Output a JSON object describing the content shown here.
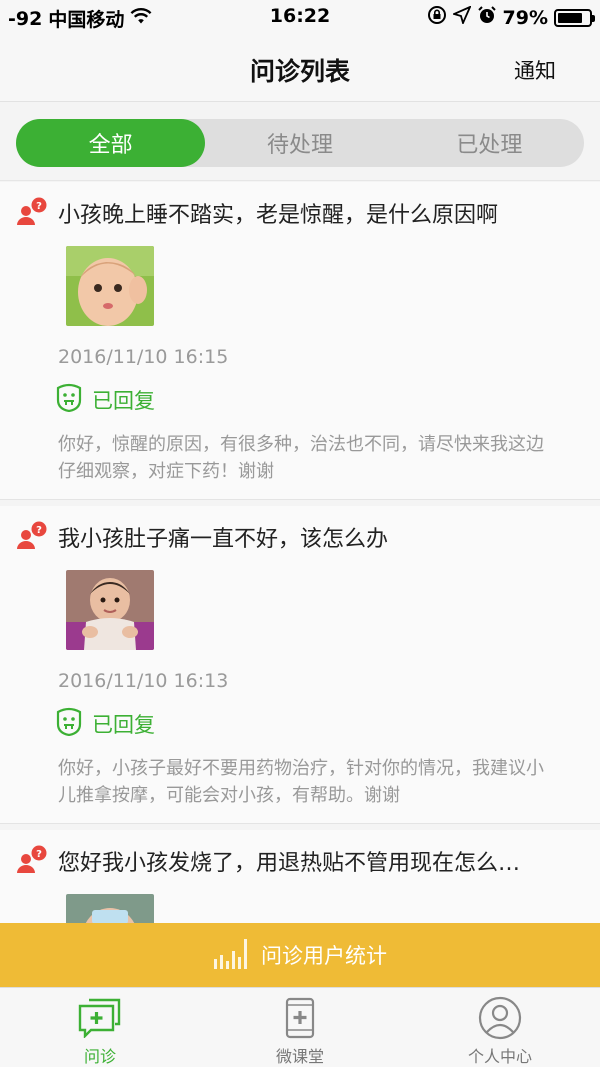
{
  "status_bar": {
    "signal": "-92",
    "carrier": "中国移动",
    "time": "16:22",
    "battery": "79%",
    "battery_level": 0.79,
    "wifi_icon": "wifi-icon",
    "lock_icon": "rotation-lock-icon",
    "location_icon": "location-arrow-icon",
    "alarm_icon": "alarm-clock-icon"
  },
  "nav": {
    "title": "问诊列表",
    "right_action": "通知"
  },
  "segment": {
    "tabs": [
      {
        "label": "全部",
        "active": true
      },
      {
        "label": "待处理",
        "active": false
      },
      {
        "label": "已处理",
        "active": false
      }
    ],
    "active_color": "#3cb034"
  },
  "consultations": [
    {
      "question": "小孩晚上睡不踏实，老是惊醒，是什么原因啊",
      "time": "2016/11/10 16:15",
      "status": "已回复",
      "reply": "你好，惊醒的原因，有很多种，治法也不同，请尽快来我这边仔细观察，对症下药！谢谢",
      "thumb_icon": "baby-photo-thumbnail"
    },
    {
      "question": "我小孩肚子痛一直不好，该怎么办",
      "time": "2016/11/10 16:13",
      "status": "已回复",
      "reply": "你好，小孩子最好不要用药物治疗，针对你的情况，我建议小儿推拿按摩，可能会对小孩，有帮助。谢谢",
      "thumb_icon": "baby-photo-thumbnail"
    },
    {
      "question": "您好我小孩发烧了，用退热贴不管用现在怎么…",
      "thumb_icon": "baby-photo-thumbnail"
    }
  ],
  "stats_bar": {
    "label": "问诊用户统计",
    "color": "#efbb36"
  },
  "tab_bar": {
    "tabs": [
      {
        "label": "问诊",
        "icon": "consultation-chat-icon",
        "active": true
      },
      {
        "label": "微课堂",
        "icon": "phone-classroom-icon",
        "active": false
      },
      {
        "label": "个人中心",
        "icon": "user-profile-icon",
        "active": false
      }
    ]
  }
}
